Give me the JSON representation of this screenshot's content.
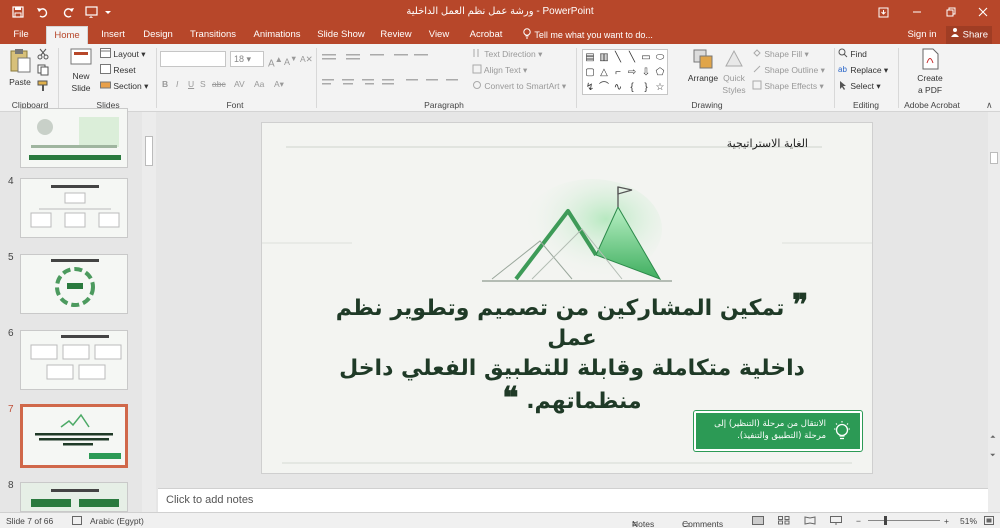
{
  "window": {
    "title": "ورشة عمل نظم العمل الداخلية  -  PowerPoint",
    "controls": [
      "minimize-icon",
      "restore-icon",
      "close-icon"
    ]
  },
  "tabs": [
    {
      "label": "File"
    },
    {
      "label": "Home",
      "active": true
    },
    {
      "label": "Insert"
    },
    {
      "label": "Design"
    },
    {
      "label": "Transitions"
    },
    {
      "label": "Animations"
    },
    {
      "label": "Slide Show"
    },
    {
      "label": "Review"
    },
    {
      "label": "View"
    },
    {
      "label": "Acrobat"
    }
  ],
  "tell_me": "Tell me what you want to do...",
  "account": {
    "sign_in": "Sign in",
    "share": "Share"
  },
  "ribbon": {
    "clipboard": {
      "paste": "Paste",
      "label": "Clipboard"
    },
    "slides": {
      "new_slide": "New",
      "new_slide2": "Slide",
      "layout": "Layout",
      "reset": "Reset",
      "section": "Section",
      "label": "Slides"
    },
    "font": {
      "size": "18",
      "label": "Font"
    },
    "paragraph": {
      "text_direction": "Text Direction",
      "align_text": "Align Text",
      "convert_smartart": "Convert to SmartArt",
      "label": "Paragraph"
    },
    "drawing": {
      "arrange": "Arrange",
      "quick_styles": "Quick",
      "quick_styles2": "Styles",
      "shape_fill": "Shape Fill",
      "shape_outline": "Shape Outline",
      "shape_effects": "Shape Effects",
      "label": "Drawing"
    },
    "editing": {
      "find": "Find",
      "replace": "Replace",
      "select": "Select",
      "label": "Editing"
    },
    "acrobat": {
      "create_pdf": "Create",
      "create_pdf2": "a PDF",
      "label": "Adobe Acrobat"
    }
  },
  "thumbnails": [
    {
      "num": ""
    },
    {
      "num": "4"
    },
    {
      "num": "5"
    },
    {
      "num": "6"
    },
    {
      "num": "7",
      "selected": true
    },
    {
      "num": "8"
    }
  ],
  "slide": {
    "heading": "الغاية الاستراتيجية",
    "quote_open": "❞",
    "quote_line1": "تمكين المشاركين من تصميم وتطوير نظم عمل",
    "quote_line2": "داخلية متكاملة  وقابلة للتطبيق الفعلي داخل",
    "quote_line3": "منظماتهم.",
    "quote_close": "❝",
    "callout_line1": "الانتقال من مرحلة (التنظير) إلى",
    "callout_line2": "مرحلة (التطبيق والتنفيذ)."
  },
  "notes_placeholder": "Click to add notes",
  "status": {
    "slide_info": "Slide 7 of 66",
    "language": "Arabic (Egypt)",
    "notes": "Notes",
    "comments": "Comments",
    "zoom": "51%"
  },
  "colors": {
    "accent": "#b7472a",
    "slide_green": "#2c9a55",
    "slide_dark_green": "#1f3a27"
  }
}
